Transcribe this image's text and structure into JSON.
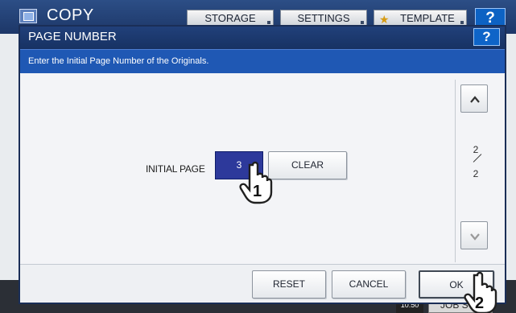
{
  "background": {
    "app_title": "COPY",
    "tabs": [
      "STORAGE",
      "SETTINGS",
      "TEMPLATE"
    ],
    "help_label": "?",
    "time": "10:50",
    "job_status_label": "JOB S"
  },
  "dialog": {
    "title": "PAGE NUMBER",
    "help_label": "?",
    "guidance": "Enter the Initial Page Number of the Originals.",
    "initial_page_label": "INITIAL PAGE",
    "initial_page_value": "3",
    "clear_label": "CLEAR",
    "page_current": "2",
    "page_total": "2",
    "reset_label": "RESET",
    "cancel_label": "CANCEL",
    "ok_label": "OK"
  },
  "callouts": [
    "1",
    "2"
  ],
  "colors": {
    "title_bar": "#1d3768",
    "guidance_bar": "#1f58b4",
    "selected_field": "#2d399b",
    "help_button": "#0e64c8"
  }
}
